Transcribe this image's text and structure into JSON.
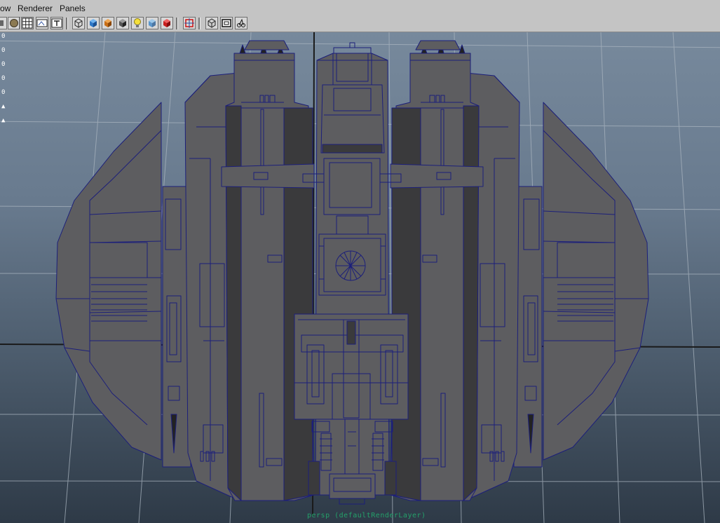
{
  "menubar": {
    "items": [
      {
        "label": "ow"
      },
      {
        "label": "Renderer"
      },
      {
        "label": "Panels"
      }
    ]
  },
  "toolbar": {
    "buttons": [
      {
        "icon": "camera-attributes-icon"
      },
      {
        "icon": "smooth-shade-sphere-icon"
      },
      {
        "icon": "grid-toggle-icon"
      },
      {
        "icon": "image-plane-icon"
      },
      {
        "icon": "textured-icon"
      },
      {
        "icon": "wireframe-cube-icon"
      },
      {
        "icon": "shaded-cube-icon"
      },
      {
        "icon": "textured-cube-icon"
      },
      {
        "icon": "shadows-cube-icon"
      },
      {
        "icon": "lighting-bulb-icon"
      },
      {
        "icon": "xray-cube-icon"
      },
      {
        "icon": "hardware-render-cube-icon"
      },
      {
        "icon": "isolate-select-icon"
      },
      {
        "icon": "xray-joints-icon"
      },
      {
        "icon": "resolution-gate-icon"
      },
      {
        "icon": "camera-joint-icon"
      }
    ]
  },
  "viewport": {
    "hud_values": [
      "0",
      "0",
      "0",
      "0",
      "0",
      "▲",
      "▲"
    ],
    "camera_label": "persp (defaultRenderLayer)"
  },
  "colors": {
    "mesh_fill": "#5d5d60",
    "mesh_dark": "#3a3a3c",
    "wire": "#1c1f7a",
    "grid": "#a9b4bf",
    "axis": "#1a1a1a",
    "camera_label": "#24a06a"
  }
}
